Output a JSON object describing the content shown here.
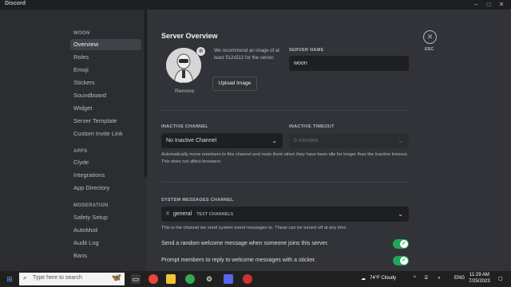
{
  "window": {
    "title": "Discord"
  },
  "sidebar": {
    "sections": [
      {
        "header": "WOON",
        "items": [
          "Overview",
          "Roles",
          "Emoji",
          "Stickers",
          "Soundboard",
          "Widget",
          "Server Template",
          "Custom Invite Link"
        ]
      },
      {
        "header": "APPS",
        "items": [
          "Clyde",
          "Integrations",
          "App Directory"
        ]
      },
      {
        "header": "MODERATION",
        "items": [
          "Safety Setup",
          "AutoMod",
          "Audit Log",
          "Bans"
        ]
      }
    ],
    "selected": "Overview"
  },
  "main": {
    "title": "Server Overview",
    "icon": {
      "recommend": "We recommend an image of at least 512x512 for the server.",
      "upload_label": "Upload Image",
      "remove_label": "Remove"
    },
    "server_name": {
      "label": "SERVER NAME",
      "value": "woon"
    },
    "inactive_channel": {
      "label": "INACTIVE CHANNEL",
      "value": "No Inactive Channel"
    },
    "inactive_timeout": {
      "label": "INACTIVE TIMEOUT",
      "value": "5 minutes"
    },
    "inactive_help": "Automatically move members to this channel and mute them when they have been idle for longer than the inactive timeout. This does not affect browsers.",
    "system_messages": {
      "label": "SYSTEM MESSAGES CHANNEL",
      "channel": "general",
      "category": "TEXT CHANNELS",
      "help": "This is the channel we send system event messages to. These can be turned off at any time."
    },
    "toggles": [
      {
        "label": "Send a random welcome message when someone joins this server.",
        "on": true
      },
      {
        "label": "Prompt members to reply to welcome messages with a sticker.",
        "on": true
      }
    ],
    "esc_label": "ESC"
  },
  "taskbar": {
    "search_placeholder": "Type here to search",
    "weather": "74°F  Cloudy",
    "language": "ENG",
    "time": "11:29 AM",
    "date": "7/25/2023"
  },
  "colors": {
    "accent_green": "#23a559",
    "sidebar_bg": "#2b2d31",
    "main_bg": "#313338"
  }
}
